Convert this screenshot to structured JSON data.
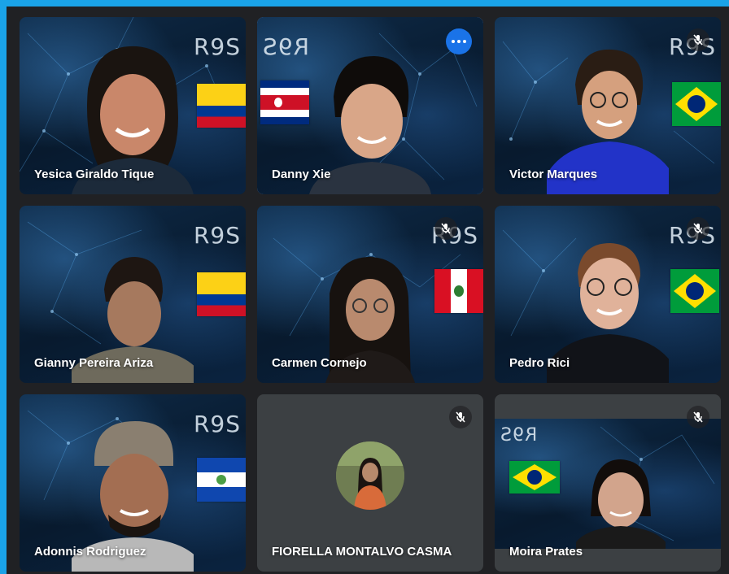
{
  "participants": [
    {
      "name": "Yesica Giraldo Tique",
      "flag": "colombia",
      "muted": true
    },
    {
      "name": "Danny Xie",
      "flag": "costa-rica",
      "muted": false,
      "speaking": true
    },
    {
      "name": "Victor Marques",
      "flag": "brazil",
      "muted": true
    },
    {
      "name": "Gianny Pereira Ariza",
      "flag": "colombia",
      "muted": true
    },
    {
      "name": "Carmen Cornejo",
      "flag": "peru",
      "muted": true
    },
    {
      "name": "Pedro Rici",
      "flag": "brazil",
      "muted": true
    },
    {
      "name": "Adonnis Rodriguez",
      "flag": "el-salvador",
      "muted": true
    },
    {
      "name": "FIORELLA MONTALVO CASMA",
      "flag": "",
      "muted": true
    },
    {
      "name": "Moira Prates",
      "flag": "brazil",
      "muted": true
    }
  ],
  "logo_text": "R9S",
  "icons": {
    "mute": "mic-off-icon",
    "more": "more-options-icon"
  },
  "colors": {
    "window_border": "#1aa3e8",
    "grid_background": "#202124",
    "active_speaker_outline": "#8ab4f8",
    "more_button": "#1a73e8",
    "blank_tile": "#3c4043"
  }
}
